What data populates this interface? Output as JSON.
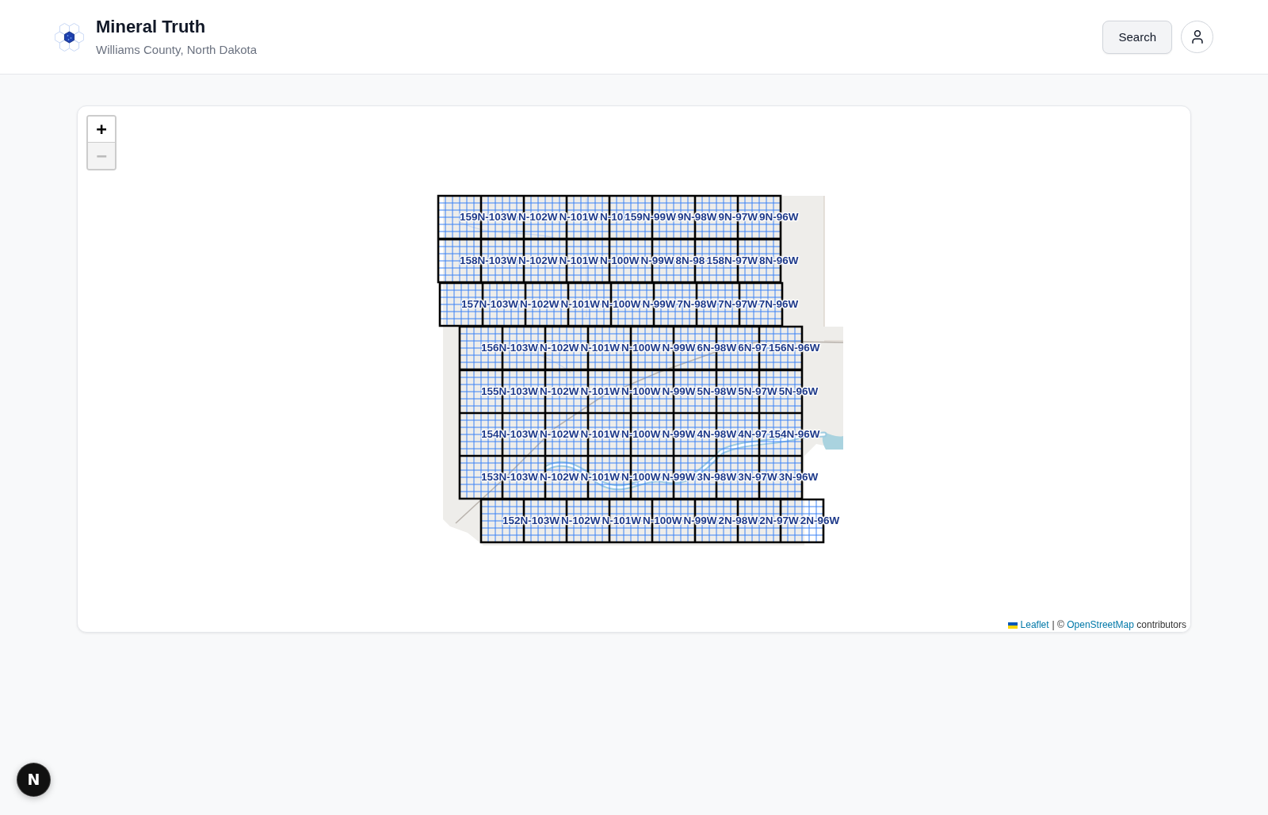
{
  "header": {
    "title": "Mineral Truth",
    "subtitle": "Williams County, North Dakota",
    "search_button": "Search"
  },
  "map": {
    "zoom_in": {
      "label": "+",
      "disabled": false
    },
    "zoom_out": {
      "label": "−",
      "disabled": true
    },
    "township_rows": [
      {
        "labels": [
          "159N-103W",
          "N-102W",
          "N-101W",
          "N-10",
          "159N-99W",
          "9N-98W",
          "9N-97W",
          "9N-96W"
        ]
      },
      {
        "labels": [
          "158N-103W",
          "N-102W",
          "N-101W",
          "N-100W",
          "N-99W",
          "8N-98",
          "158N-97W",
          "8N-96W"
        ]
      },
      {
        "labels": [
          "157N-103W",
          "N-102W",
          "N-101W",
          "N-100W",
          "N-99W",
          "7N-98W",
          "7N-97W",
          "7N-96W"
        ]
      },
      {
        "labels": [
          "156N-103W",
          "N-102W",
          "N-101W",
          "N-100W",
          "N-99W",
          "6N-98W",
          "6N-97",
          "156N-96W"
        ]
      },
      {
        "labels": [
          "155N-103W",
          "N-102W",
          "N-101W",
          "N-100W",
          "N-99W",
          "5N-98W",
          "5N-97W",
          "5N-96W"
        ]
      },
      {
        "labels": [
          "154N-103W",
          "N-102W",
          "N-101W",
          "N-100W",
          "N-99W",
          "4N-98W",
          "4N-97",
          "154N-96W"
        ]
      },
      {
        "labels": [
          "153N-103W",
          "N-102W",
          "N-101W",
          "N-100W",
          "N-99W",
          "3N-98W",
          "3N-97W",
          "3N-96W"
        ]
      },
      {
        "labels": [
          "152N-103W",
          "N-102W",
          "N-101W",
          "N-100W",
          "N-99W",
          "2N-98W",
          "2N-97W",
          "2N-96W"
        ]
      }
    ],
    "attribution": {
      "leaflet": "Leaflet",
      "before": "| ©",
      "osm": "OpenStreetMap",
      "after": "contributors"
    }
  },
  "dev_badge": {
    "label": "N"
  }
}
